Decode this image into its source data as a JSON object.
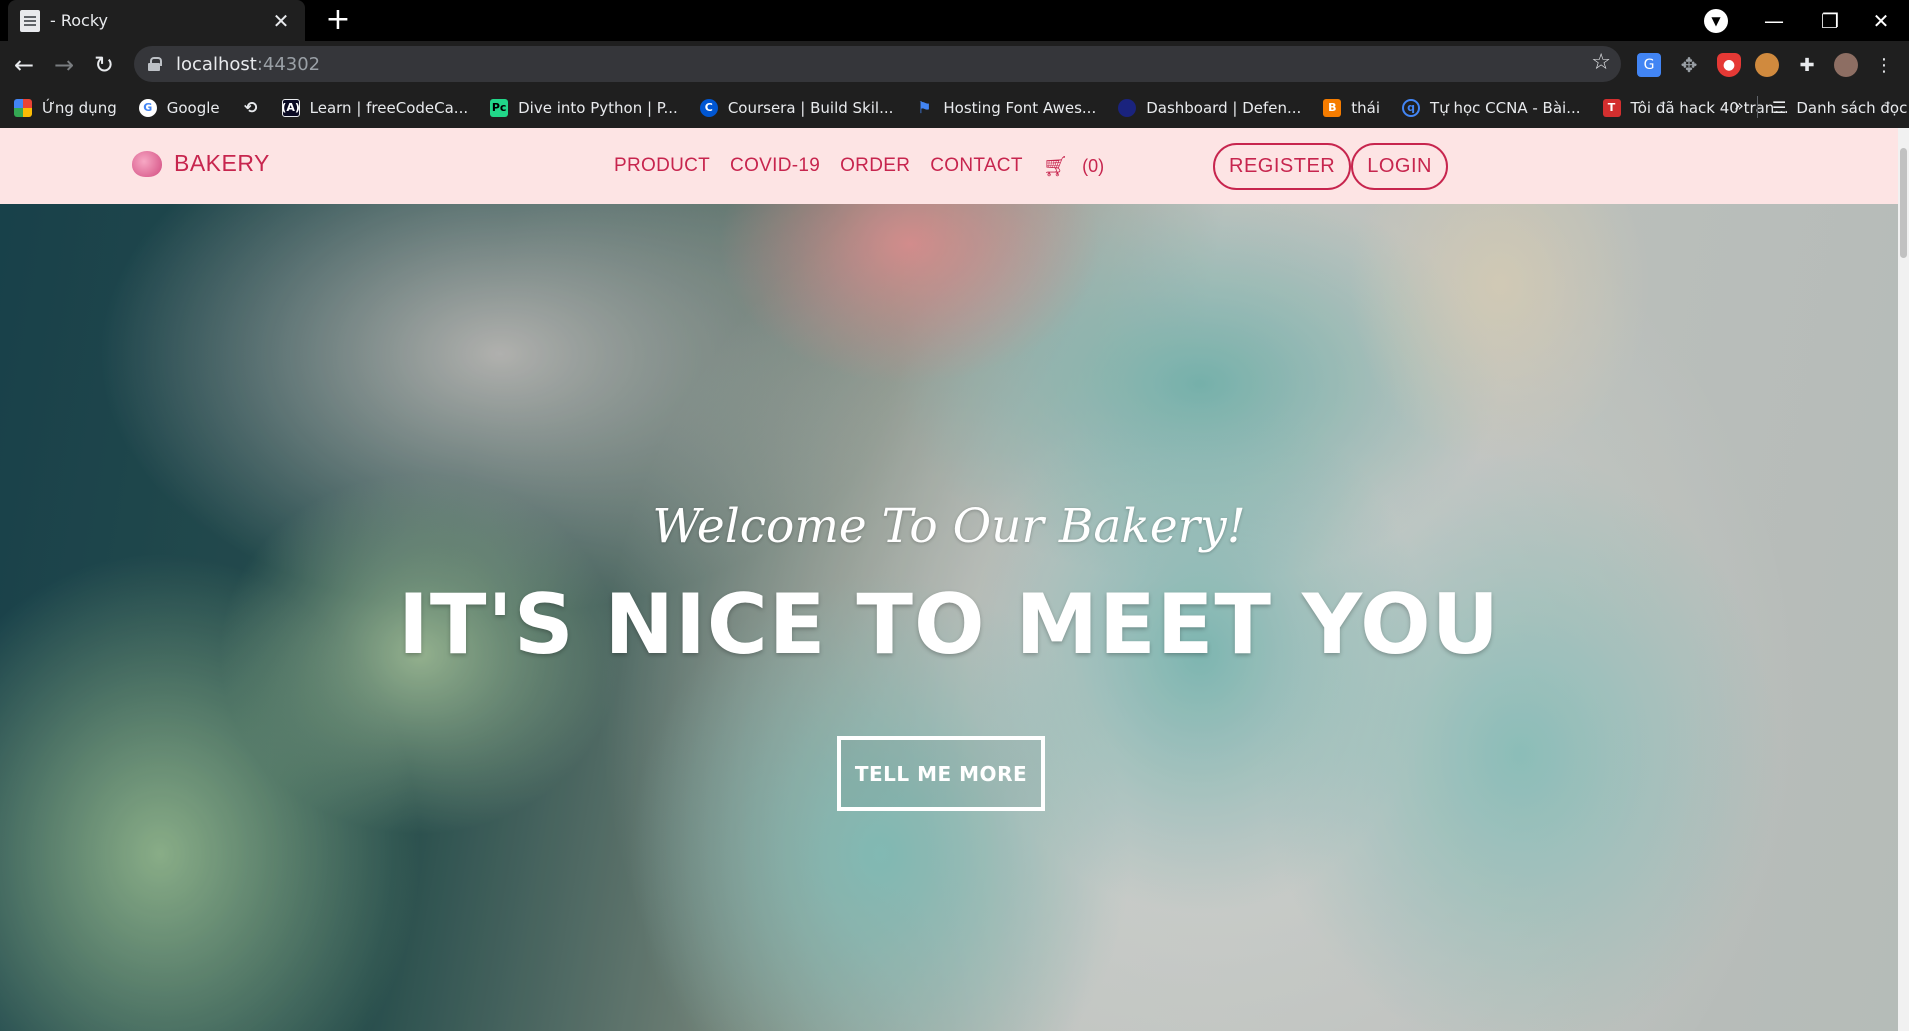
{
  "browser": {
    "tab_title": "- Rocky",
    "url_host": "localhost",
    "url_port": ":44302",
    "bookmarks": [
      {
        "label": "Ứng dụng",
        "icon": "apps-grid-icon",
        "color": "#ea4335"
      },
      {
        "label": "Google",
        "icon": "google-icon",
        "color": "#ffffff"
      },
      {
        "label": "",
        "icon": "history-icon",
        "color": "#1f1f1f"
      },
      {
        "label": "Learn | freeCodeCa...",
        "icon": "freecodecamp-icon",
        "color": "#0a0a23"
      },
      {
        "label": "Dive into Python | P...",
        "icon": "pycharm-icon",
        "color": "#21d789"
      },
      {
        "label": "Coursera | Build Skil...",
        "icon": "coursera-icon",
        "color": "#0056d2"
      },
      {
        "label": "Hosting Font Awes...",
        "icon": "flag-icon",
        "color": "#1f1f1f"
      },
      {
        "label": "Dashboard | Defen...",
        "icon": "globe-icon",
        "color": "#1a237e"
      },
      {
        "label": "thái",
        "icon": "blogger-icon",
        "color": "#f57c00"
      },
      {
        "label": "Tự học CCNA - Bài...",
        "icon": "search-q-icon",
        "color": "#1f1f1f"
      },
      {
        "label": "Tôi đã hack 40 tran...",
        "icon": "t-icon",
        "color": "#d32f2f"
      }
    ],
    "more_bookmarks": "»",
    "reading_list": "Danh sách đọc"
  },
  "site": {
    "brand": "BAKERY",
    "nav": [
      "PRODUCT",
      "COVID-19",
      "ORDER",
      "CONTACT"
    ],
    "cart_count": "(0)",
    "register": "REGISTER",
    "login": "LOGIN",
    "accent_color": "#c7254e",
    "nav_bg": "#fde4e4"
  },
  "hero": {
    "subtitle": "Welcome To Our Bakery!",
    "title": "IT'S NICE TO MEET YOU",
    "button": "TELL ME MORE"
  }
}
